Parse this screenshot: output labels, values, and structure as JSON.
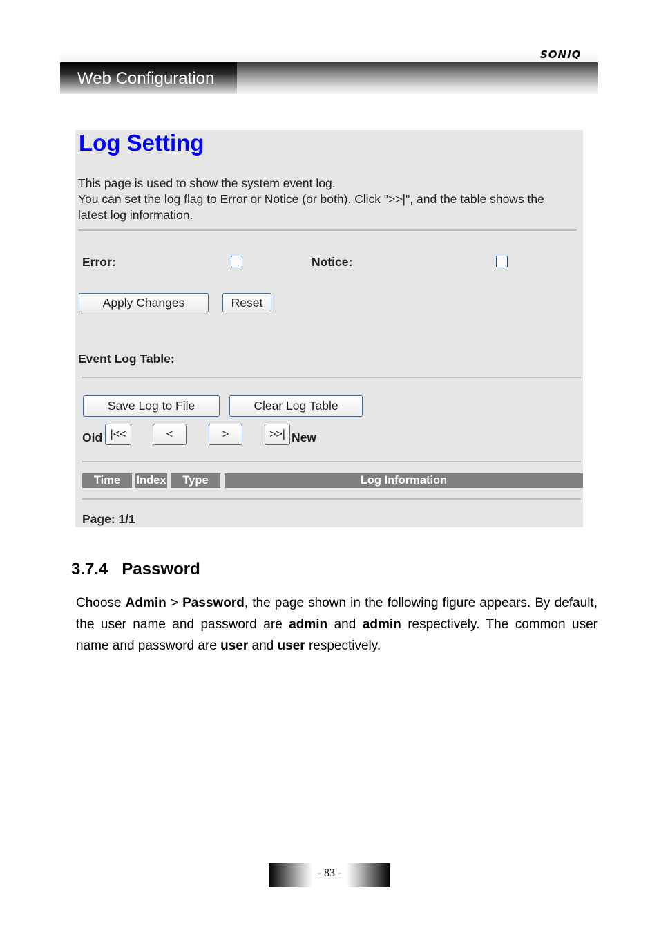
{
  "header": {
    "brand": "SONIQ",
    "section_tab": "Web Configuration"
  },
  "screenshot": {
    "title": "Log Setting",
    "description": [
      "This page is used to show the system event log.",
      "You can set the log flag to Error or Notice (or both). Click \">>|\", and the table shows the latest log information."
    ],
    "error_label": "Error:",
    "error_checked": false,
    "notice_label": "Notice:",
    "notice_checked": false,
    "apply_button": "Apply Changes",
    "reset_button": "Reset",
    "event_log_label": "Event Log Table:",
    "save_log_button": "Save Log to File",
    "clear_log_button": "Clear Log Table",
    "old_label": "Old",
    "new_label": "New",
    "nav": {
      "first": "|<<",
      "prev": "<",
      "next": ">",
      "last": ">>|"
    },
    "table_headers": [
      "Time",
      "Index",
      "Type",
      "Log Information"
    ],
    "page_label": "Page: 1/1"
  },
  "section": {
    "number": "3.7.4",
    "title": "Password",
    "paragraph": [
      {
        "t": "Choose ",
        "b": false
      },
      {
        "t": "Admin",
        "b": true
      },
      {
        "t": " > ",
        "b": false
      },
      {
        "t": "Password",
        "b": true
      },
      {
        "t": ", the page shown in the following figure appears. By default, the user name and password are ",
        "b": false
      },
      {
        "t": "admin",
        "b": true
      },
      {
        "t": " and ",
        "b": false
      },
      {
        "t": "admin",
        "b": true
      },
      {
        "t": " respectively. The common user name and password are ",
        "b": false
      },
      {
        "t": "user",
        "b": true
      },
      {
        "t": " and ",
        "b": false
      },
      {
        "t": "user",
        "b": true
      },
      {
        "t": " respectively.",
        "b": false
      }
    ]
  },
  "footer": {
    "page_number": "- 83 -"
  }
}
